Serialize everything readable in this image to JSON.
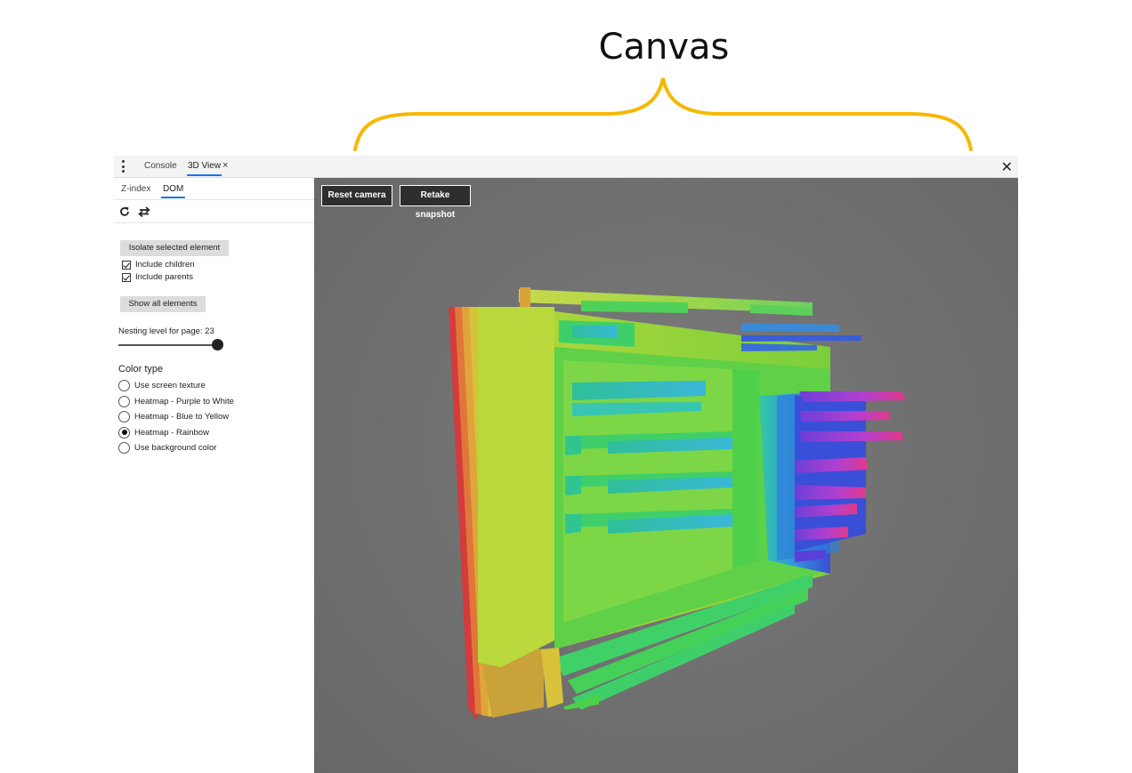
{
  "annotation": {
    "title": "Canvas",
    "brace_color": "#f5b800"
  },
  "tabbar": {
    "tabs": [
      {
        "label": "Console",
        "active": false
      },
      {
        "label": "3D View",
        "active": true
      }
    ],
    "tab_close": "×",
    "panel_close": "✕"
  },
  "sidebar": {
    "subtabs": [
      {
        "label": "Z-index",
        "active": false
      },
      {
        "label": "DOM",
        "active": true
      }
    ],
    "toolbar_icons": [
      "refresh-icon",
      "swap-icon"
    ],
    "isolate_button": "Isolate selected element",
    "include_children": {
      "label": "Include children",
      "checked": true
    },
    "include_parents": {
      "label": "Include parents",
      "checked": true
    },
    "show_all_button": "Show all elements",
    "nesting_label": "Nesting level for page: 23",
    "nesting_level": 23,
    "nesting_max": 23,
    "color_type_label": "Color type",
    "color_options": [
      {
        "label": "Use screen texture",
        "selected": false
      },
      {
        "label": "Heatmap - Purple to White",
        "selected": false
      },
      {
        "label": "Heatmap - Blue to Yellow",
        "selected": false
      },
      {
        "label": "Heatmap - Rainbow",
        "selected": true
      },
      {
        "label": "Use background color",
        "selected": false
      }
    ]
  },
  "canvas": {
    "reset_button": "Reset camera",
    "retake_button": "Retake snapshot",
    "background": "#707070"
  }
}
